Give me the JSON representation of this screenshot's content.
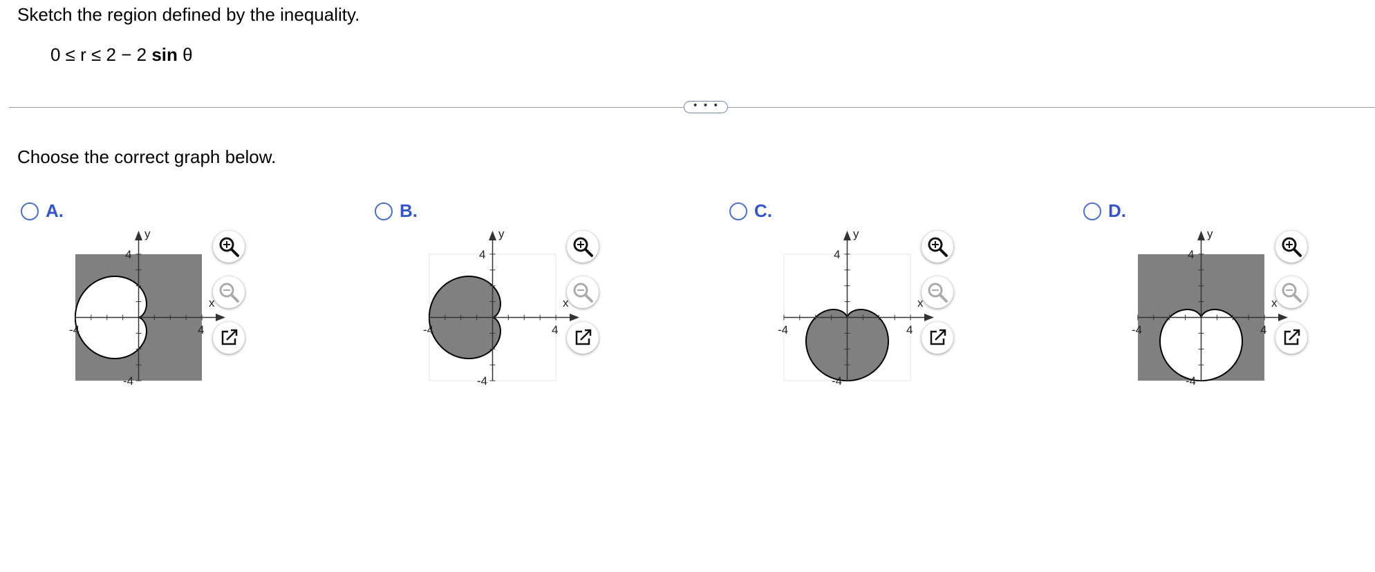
{
  "question": {
    "prompt": "Sketch the region defined by the inequality.",
    "equation_left": "0 ≤ r ≤ 2 − 2 ",
    "equation_sin": "sin",
    "equation_theta": " θ"
  },
  "more_button": "• • •",
  "instruction": "Choose the correct graph below.",
  "options": [
    {
      "letter": "A.",
      "axis_x": "x",
      "axis_y": "y",
      "tick_pos": "4",
      "tick_neg": "-4"
    },
    {
      "letter": "B.",
      "axis_x": "x",
      "axis_y": "y",
      "tick_pos": "4",
      "tick_neg": "-4"
    },
    {
      "letter": "C.",
      "axis_x": "x",
      "axis_y": "y",
      "tick_pos": "4",
      "tick_neg": "-4"
    },
    {
      "letter": "D.",
      "axis_x": "x",
      "axis_y": "y",
      "tick_pos": "4",
      "tick_neg": "-4"
    }
  ],
  "tools": {
    "zoom_in": "zoom-in-icon",
    "zoom_out": "zoom-out-icon",
    "popout": "popout-icon"
  },
  "colors": {
    "fill": "#808080",
    "option_letter": "#3355cc",
    "radio": "#4a6fd0"
  }
}
